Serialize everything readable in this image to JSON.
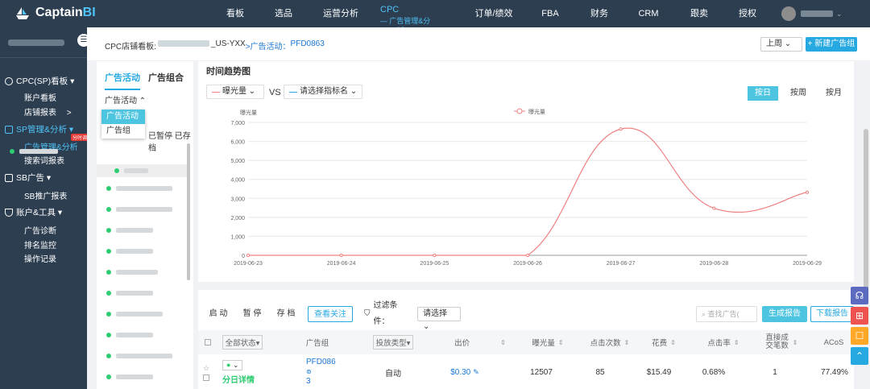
{
  "brand": {
    "captain": "Captain",
    "bi": "BI"
  },
  "nav": {
    "items": [
      "看板",
      "选品",
      "运营分析",
      "订单/绩效",
      "FBA",
      "财务",
      "CRM",
      "跟卖",
      "授权"
    ],
    "cpc": {
      "top": "CPC",
      "sub": "— 广告管理&分析 —"
    }
  },
  "sidebar": {
    "groups": [
      {
        "label": "CPC(SP)看板 ▾",
        "items": [
          "账户看板",
          "店铺报表 　>"
        ]
      },
      {
        "label": "SP管理&分析 ▾",
        "items": [
          "广告管理&分析",
          "搜索词报表"
        ],
        "badge": "分时调价"
      },
      {
        "label": "SB广告 ▾",
        "items": [
          "SB推广报表"
        ]
      },
      {
        "label": "账户&工具 ▾",
        "items": [
          "广告诊断",
          "排名监控",
          "操作记录"
        ]
      }
    ]
  },
  "breadcrumb": {
    "a": "CPC店铺看板:",
    "b": "_US-YXX",
    "c": ">广告活动：",
    "d": "PFD0863"
  },
  "period_select": "上周 ⌄",
  "new_group_btn": "+ 新建广告组",
  "left": {
    "tabs": [
      "广告活动",
      "广告组合"
    ],
    "type_select": "广告活动 ⌃",
    "dropdown": [
      "广告活动",
      "广告组"
    ],
    "status_text": "已暂停 已存档"
  },
  "chart_card": {
    "title": "时间趋势图",
    "metric1": "曝光量 ⌄",
    "vs": "VS",
    "metric2": "请选择指标名 ⌄",
    "granularity": [
      "按日",
      "按周",
      "按月"
    ]
  },
  "chart_data": {
    "type": "line",
    "ylabel": "曝光量",
    "legend": "曝光量",
    "x": [
      "2019-06-23",
      "2019-06-24",
      "2019-06-25",
      "2019-06-26",
      "2019-06-27",
      "2019-06-28",
      "2019-06-29"
    ],
    "series": [
      {
        "name": "曝光量",
        "values": [
          0,
          0,
          0,
          0,
          6650,
          2480,
          3320
        ]
      }
    ],
    "yticks": [
      "0",
      "1,000",
      "2,000",
      "3,000",
      "4,000",
      "5,000",
      "6,000",
      "7,000"
    ],
    "ylim": [
      0,
      7000
    ],
    "color": "#f08080"
  },
  "table": {
    "buttons": {
      "start": "启 动",
      "pause": "暂 停",
      "archive": "存 档",
      "follow": "查看关注"
    },
    "filter_label": "过滤条件：",
    "filter_select": "请选择 ⌄",
    "search_placeholder": "查找广告(",
    "gen_report": "生成报告",
    "download": "下载报告",
    "headers": [
      "全部状态▾",
      "广告组",
      "投放类型▾",
      "出价",
      "曝光量",
      "点击次数",
      "花费",
      "点击率",
      "直接成交笔数",
      "ACoS"
    ],
    "row": {
      "detail": "分日详情",
      "group": "PFD086",
      "group_suffix": "3",
      "type": "自动",
      "bid": "$0.30",
      "impr": "12507",
      "clicks": "85",
      "spend": "$15.49",
      "ctr": "0.68%",
      "orders": "1",
      "acos": "77.49%"
    }
  },
  "colors": {
    "dark": "#2c3e50",
    "accent": "#4ec5e0",
    "blue": "#26a9e0",
    "line": "#f08080",
    "green": "#2ecc71"
  }
}
